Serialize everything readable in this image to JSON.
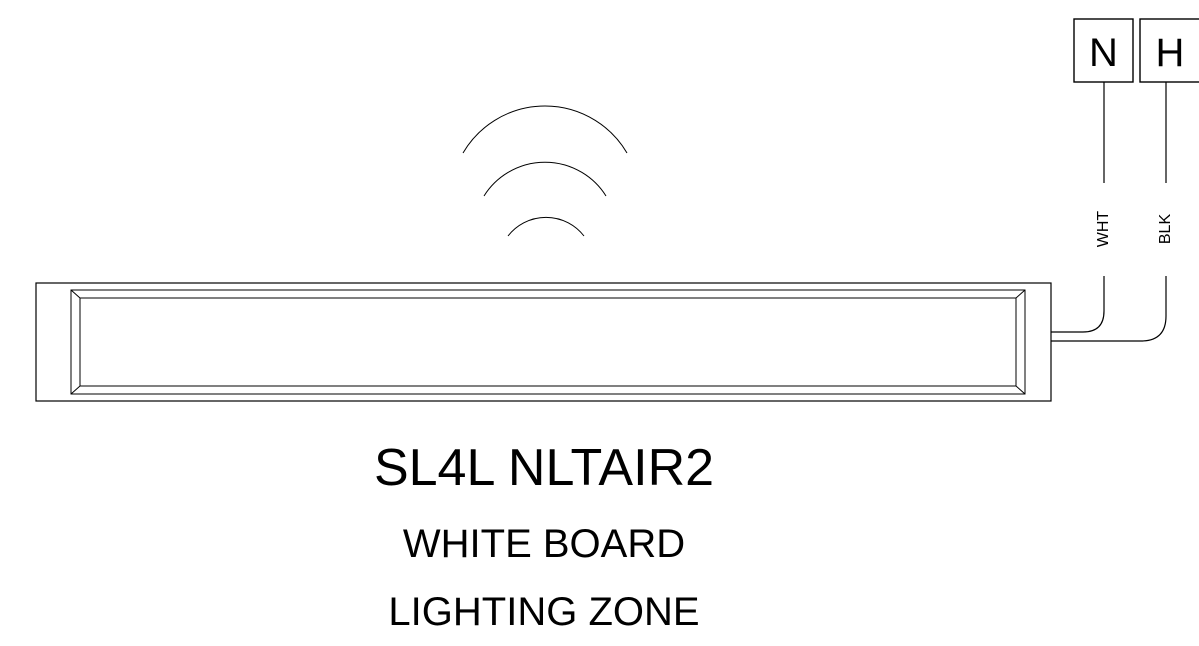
{
  "diagram": {
    "model": "SL4L NLTAIR2",
    "line2": "WHITE BOARD",
    "line3": "LIGHTING ZONE",
    "terminals": {
      "neutral": "N",
      "hot": "H"
    },
    "wires": {
      "neutral_color": "WHT",
      "hot_color": "BLK"
    },
    "wireless_icon": "wireless-signal-icon"
  }
}
